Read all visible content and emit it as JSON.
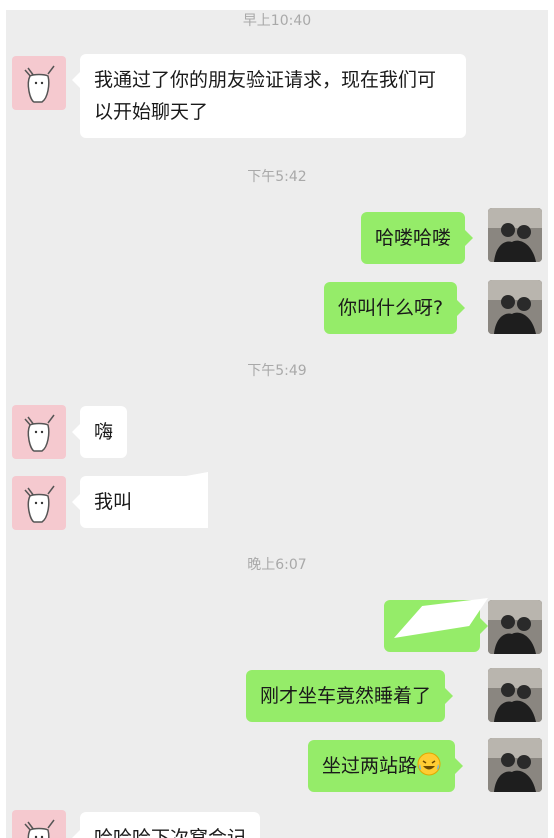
{
  "timestamps": [
    "早上10:40",
    "下午5:42",
    "下午5:49",
    "晚上6:07"
  ],
  "messages": [
    {
      "side": "in",
      "text": "我通过了你的朋友验证请求，现在我们可以开始聊天了"
    },
    {
      "side": "out",
      "text": "哈喽哈喽"
    },
    {
      "side": "out",
      "text": "你叫什么呀?"
    },
    {
      "side": "in",
      "text": "嗨"
    },
    {
      "side": "in",
      "text": "我叫"
    },
    {
      "side": "out",
      "text": ""
    },
    {
      "side": "out",
      "text": "刚才坐车竟然睡着了"
    },
    {
      "side": "out",
      "text": "坐过两站路",
      "emoji": "laughing-tears-emoji"
    },
    {
      "side": "in",
      "text": "哈哈哈下次窝会记"
    }
  ],
  "avatars": {
    "contact": "cat-sticker-avatar",
    "me": "photo-avatar"
  },
  "colors": {
    "background": "#ededed",
    "incoming_bubble": "#ffffff",
    "outgoing_bubble": "#95ec69",
    "timestamp": "#a9a9a9"
  }
}
